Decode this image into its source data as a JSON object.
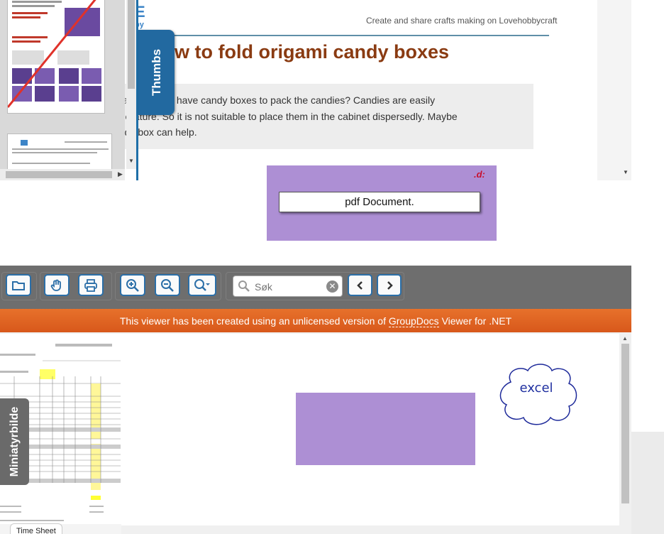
{
  "top_viewer": {
    "thumbs_tab_label": "Thumbs",
    "site_logo": "LOVE\nhobbycraft",
    "site_tagline": "Create and share crafts making on Lovehobbycraft",
    "article_title": "w to fold origami candy boxes",
    "intro_lines": [
      "ou        yed that you don’t have candy boxes to pack the candies? Candies are easily",
      "        in   ot temperature. So it is not suitable to place them in the cabinet dispersedly. Maybe",
      "origami c    dy box can help."
    ]
  },
  "pdf_block": {
    "label": "pdf Document.",
    "logo": ".d:"
  },
  "toolbar": {
    "open_title": "Open",
    "search_placeholder": "Søk"
  },
  "banner": {
    "prefix": "This viewer has been created using an unlicensed version of ",
    "link": "GroupDocs",
    "suffix": " Viewer for .NET"
  },
  "excel_viewer": {
    "mini_tab_label": "Miniatyrbilde",
    "sheet_tab_label": "Time Sheet",
    "cloud_label": "excel",
    "purple_color": "#ad8fd4",
    "accent_color": "#2b6fa8",
    "banner_color": "#e06425"
  }
}
